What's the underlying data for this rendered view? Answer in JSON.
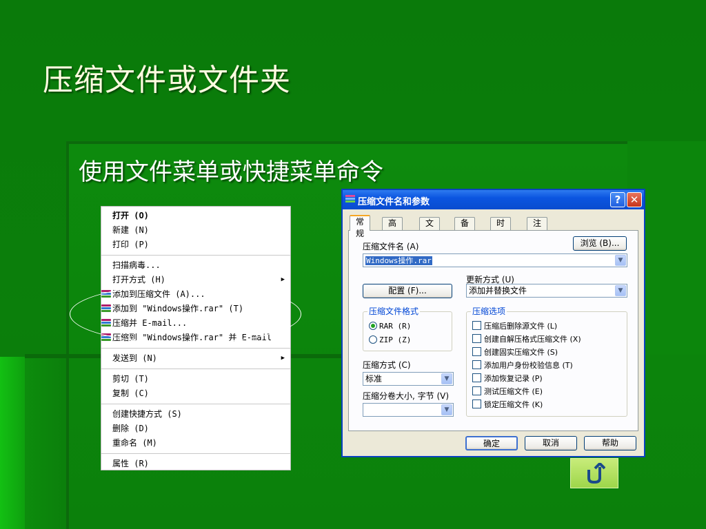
{
  "slide": {
    "title": "压缩文件或文件夹",
    "subtitle": "使用文件菜单或快捷菜单命令"
  },
  "context_menu": {
    "items": [
      {
        "label": "打开 (O)",
        "bold": true
      },
      {
        "label": "新建 (N)"
      },
      {
        "label": "打印 (P)"
      },
      {
        "label": "扫描病毒..."
      },
      {
        "label": "打开方式 (H)",
        "submenu": true
      },
      {
        "label": "添加到压缩文件 (A)...",
        "icon": "winrar-icon"
      },
      {
        "label": "添加到 \"Windows操作.rar\" (T)",
        "icon": "winrar-icon"
      },
      {
        "label": "压缩并 E-mail...",
        "icon": "winrar-icon"
      },
      {
        "label": "压缩到 \"Windows操作.rar\" 并 E-mail",
        "icon": "winrar-icon"
      },
      {
        "label": "发送到 (N)",
        "submenu": true
      },
      {
        "label": "剪切 (T)"
      },
      {
        "label": "复制 (C)"
      },
      {
        "label": "创建快捷方式 (S)"
      },
      {
        "label": "删除 (D)"
      },
      {
        "label": "重命名 (M)"
      },
      {
        "label": "属性 (R)"
      }
    ]
  },
  "dialog": {
    "title": "压缩文件名和参数",
    "help_glyph": "?",
    "close_glyph": "✕",
    "tabs": [
      "常规",
      "高级",
      "文件",
      "备份",
      "时间",
      "注释"
    ],
    "active_tab": "常规",
    "archive_name_label": "压缩文件名 (A)",
    "browse_button": "浏览 (B)...",
    "archive_name_value": "Windows操作.rar",
    "update_mode_label": "更新方式 (U)",
    "update_mode_value": "添加并替换文件",
    "profiles_button": "配置 (F)...",
    "format_group": {
      "legend": "压缩文件格式",
      "options": [
        {
          "label": "RAR (R)",
          "selected": true
        },
        {
          "label": "ZIP (Z)",
          "selected": false
        }
      ]
    },
    "options_group": {
      "legend": "压缩选项",
      "checkboxes": [
        {
          "label": "压缩后删除源文件 (L)",
          "checked": false
        },
        {
          "label": "创建自解压格式压缩文件 (X)",
          "checked": false
        },
        {
          "label": "创建固实压缩文件 (S)",
          "checked": false
        },
        {
          "label": "添加用户身份校验信息 (T)",
          "checked": false
        },
        {
          "label": "添加恢复记录 (P)",
          "checked": false
        },
        {
          "label": "测试压缩文件 (E)",
          "checked": false
        },
        {
          "label": "锁定压缩文件 (K)",
          "checked": false
        }
      ]
    },
    "method_label": "压缩方式 (C)",
    "method_value": "标准",
    "volume_label": "压缩分卷大小, 字节 (V)",
    "volume_value": "",
    "ok_button": "确定",
    "cancel_button": "取消",
    "help_button": "帮助"
  },
  "colors": {
    "background": "#0b7f0b",
    "title_text": "#fffbe0",
    "xp_titlebar": "#0a4ccf",
    "group_legend": "#0046d5"
  },
  "icons": {
    "back": "return-arrow-icon",
    "rar": "winrar-icon"
  }
}
